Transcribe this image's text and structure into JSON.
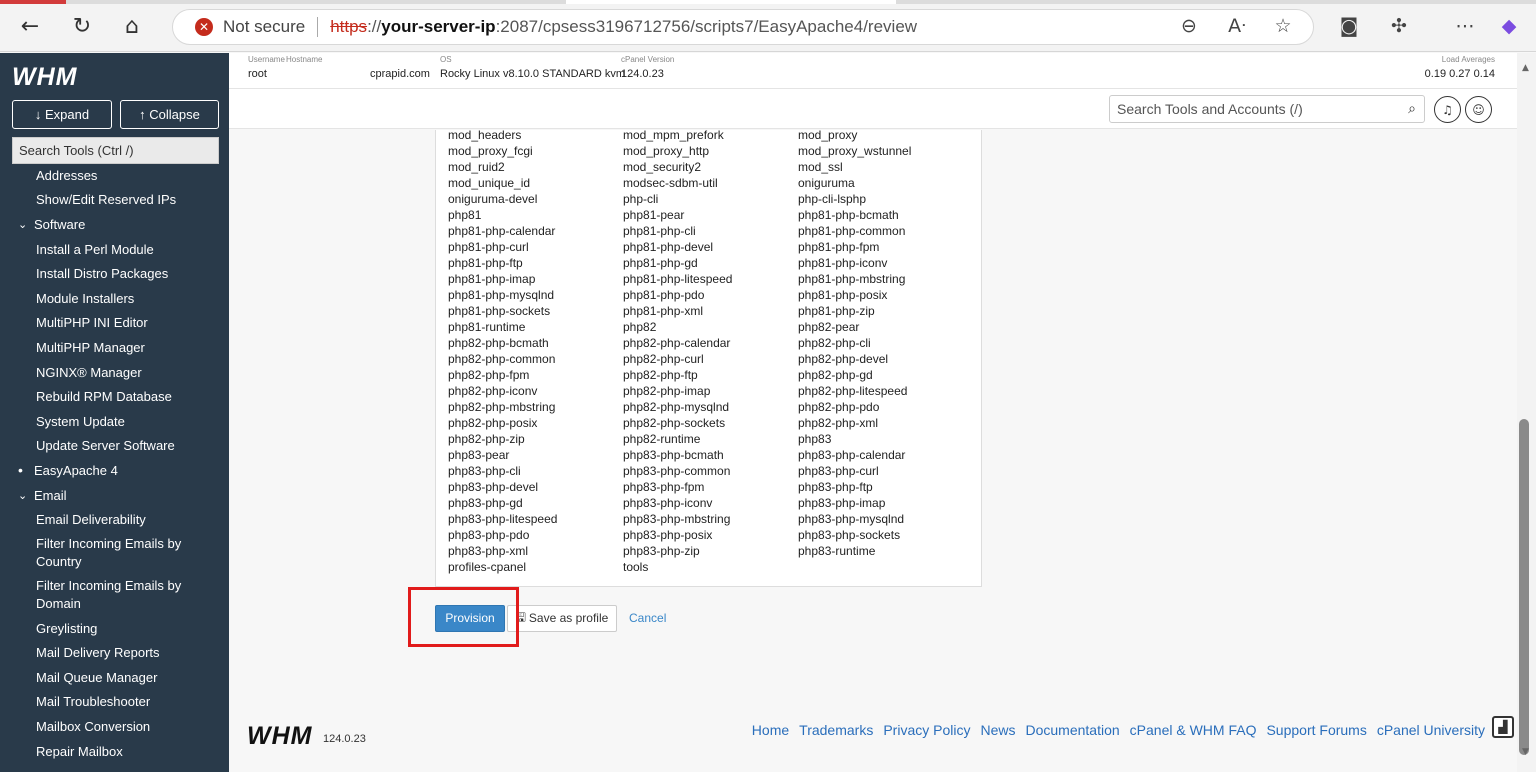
{
  "browser": {
    "not_secure": "Not secure",
    "url_scheme": "https",
    "url_slashes": "://",
    "url_host": "your-server-ip",
    "url_path": ":2087/cpsess3196712756/scripts7/EasyApache4/review"
  },
  "sidebar": {
    "logo": "WHM",
    "expand_label": "↓ Expand",
    "collapse_label": "↑ Collapse",
    "search_placeholder": "Search Tools (Ctrl /)",
    "items": [
      {
        "label": "Addresses",
        "kind": "item"
      },
      {
        "label": "Show/Edit Reserved IPs",
        "kind": "item"
      },
      {
        "label": "Software",
        "kind": "section"
      },
      {
        "label": "Install a Perl Module",
        "kind": "item"
      },
      {
        "label": "Install Distro Packages",
        "kind": "item"
      },
      {
        "label": "Module Installers",
        "kind": "item"
      },
      {
        "label": "MultiPHP INI Editor",
        "kind": "item"
      },
      {
        "label": "MultiPHP Manager",
        "kind": "item"
      },
      {
        "label": "NGINX® Manager",
        "kind": "item"
      },
      {
        "label": "Rebuild RPM Database",
        "kind": "item"
      },
      {
        "label": "System Update",
        "kind": "item"
      },
      {
        "label": "Update Server Software",
        "kind": "item"
      },
      {
        "label": "EasyApache 4",
        "kind": "active"
      },
      {
        "label": "Email",
        "kind": "section"
      },
      {
        "label": "Email Deliverability",
        "kind": "item"
      },
      {
        "label": "Filter Incoming Emails by Country",
        "kind": "multi"
      },
      {
        "label": "Filter Incoming Emails by Domain",
        "kind": "multi"
      },
      {
        "label": "Greylisting",
        "kind": "item"
      },
      {
        "label": "Mail Delivery Reports",
        "kind": "item"
      },
      {
        "label": "Mail Queue Manager",
        "kind": "item"
      },
      {
        "label": "Mail Troubleshooter",
        "kind": "item"
      },
      {
        "label": "Mailbox Conversion",
        "kind": "item"
      },
      {
        "label": "Repair Mailbox",
        "kind": "item"
      }
    ]
  },
  "topinfo": {
    "username_label": "Username",
    "username": "root",
    "hostname_label": "Hostname",
    "hostname": "cprapid.com",
    "os_label": "OS",
    "os": "Rocky Linux v8.10.0 STANDARD kvm",
    "cpanel_label": "cPanel Version",
    "cpanel": "124.0.23",
    "load_label": "Load Averages",
    "load": "0.19  0.27  0.14"
  },
  "toolbar": {
    "search_placeholder": "Search Tools and Accounts (/)"
  },
  "packages": [
    [
      "mod_headers",
      "mod_mpm_prefork",
      "mod_proxy"
    ],
    [
      "mod_proxy_fcgi",
      "mod_proxy_http",
      "mod_proxy_wstunnel"
    ],
    [
      "mod_ruid2",
      "mod_security2",
      "mod_ssl"
    ],
    [
      "mod_unique_id",
      "modsec-sdbm-util",
      "oniguruma"
    ],
    [
      "oniguruma-devel",
      "php-cli",
      "php-cli-lsphp"
    ],
    [
      "php81",
      "php81-pear",
      "php81-php-bcmath"
    ],
    [
      "php81-php-calendar",
      "php81-php-cli",
      "php81-php-common"
    ],
    [
      "php81-php-curl",
      "php81-php-devel",
      "php81-php-fpm"
    ],
    [
      "php81-php-ftp",
      "php81-php-gd",
      "php81-php-iconv"
    ],
    [
      "php81-php-imap",
      "php81-php-litespeed",
      "php81-php-mbstring"
    ],
    [
      "php81-php-mysqlnd",
      "php81-php-pdo",
      "php81-php-posix"
    ],
    [
      "php81-php-sockets",
      "php81-php-xml",
      "php81-php-zip"
    ],
    [
      "php81-runtime",
      "php82",
      "php82-pear"
    ],
    [
      "php82-php-bcmath",
      "php82-php-calendar",
      "php82-php-cli"
    ],
    [
      "php82-php-common",
      "php82-php-curl",
      "php82-php-devel"
    ],
    [
      "php82-php-fpm",
      "php82-php-ftp",
      "php82-php-gd"
    ],
    [
      "php82-php-iconv",
      "php82-php-imap",
      "php82-php-litespeed"
    ],
    [
      "php82-php-mbstring",
      "php82-php-mysqlnd",
      "php82-php-pdo"
    ],
    [
      "php82-php-posix",
      "php82-php-sockets",
      "php82-php-xml"
    ],
    [
      "php82-php-zip",
      "php82-runtime",
      "php83"
    ],
    [
      "php83-pear",
      "php83-php-bcmath",
      "php83-php-calendar"
    ],
    [
      "php83-php-cli",
      "php83-php-common",
      "php83-php-curl"
    ],
    [
      "php83-php-devel",
      "php83-php-fpm",
      "php83-php-ftp"
    ],
    [
      "php83-php-gd",
      "php83-php-iconv",
      "php83-php-imap"
    ],
    [
      "php83-php-litespeed",
      "php83-php-mbstring",
      "php83-php-mysqlnd"
    ],
    [
      "php83-php-pdo",
      "php83-php-posix",
      "php83-php-sockets"
    ],
    [
      "php83-php-xml",
      "php83-php-zip",
      "php83-runtime"
    ],
    [
      "profiles-cpanel",
      "tools",
      ""
    ]
  ],
  "actions": {
    "provision": "Provision",
    "save_profile": "Save as profile",
    "cancel": "Cancel"
  },
  "footer": {
    "logo": "WHM",
    "version": "124.0.23",
    "links": [
      "Home",
      "Trademarks",
      "Privacy Policy",
      "News",
      "Documentation",
      "cPanel & WHM FAQ",
      "Support Forums",
      "cPanel University"
    ]
  },
  "colors": {
    "sidebar_bg": "#293a4a",
    "primary_button": "#3a87c8",
    "highlight_box": "#e11b1b",
    "link": "#2a6ebb"
  }
}
